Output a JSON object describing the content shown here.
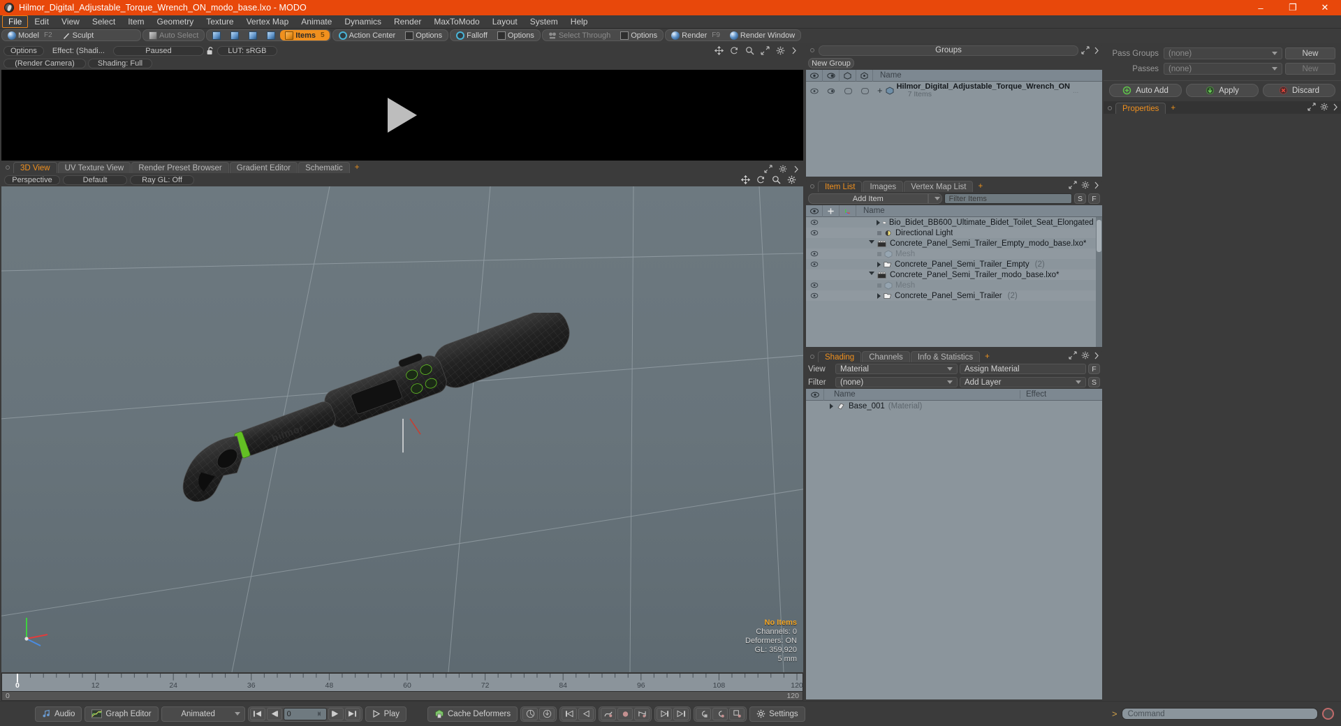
{
  "window": {
    "title": "Hilmor_Digital_Adjustable_Torque_Wrench_ON_modo_base.lxo - MODO",
    "minimize": "–",
    "maximize": "❐",
    "close": "✕"
  },
  "menubar": {
    "items": [
      {
        "label": "File",
        "active": true
      },
      {
        "label": "Edit",
        "active": false
      },
      {
        "label": "View",
        "active": false
      },
      {
        "label": "Select",
        "active": false
      },
      {
        "label": "Item",
        "active": false
      },
      {
        "label": "Geometry",
        "active": false
      },
      {
        "label": "Texture",
        "active": false
      },
      {
        "label": "Vertex Map",
        "active": false
      },
      {
        "label": "Animate",
        "active": false
      },
      {
        "label": "Dynamics",
        "active": false
      },
      {
        "label": "Render",
        "active": false
      },
      {
        "label": "MaxToModo",
        "active": false
      },
      {
        "label": "Layout",
        "active": false
      },
      {
        "label": "System",
        "active": false
      },
      {
        "label": "Help",
        "active": false
      }
    ]
  },
  "modebar": {
    "model": "Model",
    "model_key": "F2",
    "sculpt": "Sculpt",
    "auto_select": "Auto Select",
    "items": "Items",
    "items_key": "5",
    "action_center": "Action Center",
    "options1": "Options",
    "falloff": "Falloff",
    "options2": "Options",
    "select_through": "Select Through",
    "options3": "Options",
    "render": "Render",
    "render_key": "F9",
    "render_window": "Render Window"
  },
  "render_preview": {
    "options": "Options",
    "effect": "Effect: (Shadi...",
    "paused": "Paused",
    "lut": "LUT: sRGB",
    "camera": "(Render Camera)",
    "shading": "Shading: Full",
    "lock_icon": "unlock-icon",
    "play_icon": "play-triangle"
  },
  "viewport": {
    "tabs": [
      {
        "label": "3D View",
        "active": true
      },
      {
        "label": "UV Texture View",
        "active": false
      },
      {
        "label": "Render Preset Browser",
        "active": false
      },
      {
        "label": "Gradient Editor",
        "active": false
      },
      {
        "label": "Schematic",
        "active": false
      }
    ],
    "tab_add": "+",
    "header": {
      "perspective": "Perspective",
      "shading": "Default",
      "raygl": "Ray GL: Off"
    },
    "stats": {
      "selection": "No Items",
      "channels": "Channels: 0",
      "deformers": "Deformers: ON",
      "gl": "GL: 359,920",
      "scale": "5 mm"
    },
    "axis": {
      "x": "X",
      "y": "Y",
      "z": "Z"
    }
  },
  "timeline": {
    "ticks": [
      "0",
      "12",
      "24",
      "36",
      "48",
      "60",
      "72",
      "84",
      "96",
      "108",
      "120"
    ],
    "range_start": "0",
    "range_end": "120",
    "current_frame": 0
  },
  "bottombar": {
    "audio": "Audio",
    "graph_editor": "Graph Editor",
    "mode": "Animated",
    "frame_value": "0",
    "play": "Play",
    "cache_deformers": "Cache Deformers",
    "settings": "Settings",
    "transport": {
      "first": "⏮",
      "prev": "⏴",
      "next": "⏵",
      "last": "⏭"
    }
  },
  "groups_panel": {
    "title": "Groups",
    "new_group": "New Group",
    "columns": [
      "eye-icon",
      "render-icon",
      "shade-icon",
      "lock-icon",
      "Name"
    ],
    "name_column": "Name",
    "rows": [
      {
        "name": "Hilmor_Digital_Adjustable_Torque_Wrench_ON",
        "sub": "7 Items",
        "ellipsis": "..."
      }
    ]
  },
  "item_list_panel": {
    "tabs": [
      {
        "label": "Item List",
        "active": true
      },
      {
        "label": "Images",
        "active": false
      },
      {
        "label": "Vertex Map List",
        "active": false
      }
    ],
    "tab_add": "+",
    "add_item": "Add Item",
    "filter_placeholder": "Filter Items",
    "btn_s": "S",
    "btn_f": "F",
    "name_column": "Name",
    "rows": [
      {
        "name": "Bio_Bidet_BB600_Ultimate_Bidet_Toilet_Seat_Elongated",
        "icon": "folder-icon",
        "indent": 2,
        "arrow": "right",
        "dim": false,
        "trail": "...",
        "eye": true
      },
      {
        "name": "Directional Light",
        "icon": "light-icon",
        "indent": 2,
        "arrow": "none",
        "dim": false,
        "eye": true
      },
      {
        "name": "Concrete_Panel_Semi_Trailer_Empty_modo_base.lxo*",
        "icon": "scene-icon",
        "indent": 1,
        "arrow": "down",
        "dim": false,
        "eye": false
      },
      {
        "name": "Mesh",
        "icon": "mesh-icon",
        "indent": 2,
        "arrow": "none",
        "dim": true,
        "eye": true
      },
      {
        "name": "Concrete_Panel_Semi_Trailer_Empty",
        "icon": "folder-icon",
        "indent": 2,
        "arrow": "right",
        "dim": false,
        "count": "(2)",
        "eye": true
      },
      {
        "name": "Concrete_Panel_Semi_Trailer_modo_base.lxo*",
        "icon": "scene-icon",
        "indent": 1,
        "arrow": "down",
        "dim": false,
        "eye": false
      },
      {
        "name": "Mesh",
        "icon": "mesh-icon",
        "indent": 2,
        "arrow": "none",
        "dim": true,
        "eye": true
      },
      {
        "name": "Concrete_Panel_Semi_Trailer",
        "icon": "folder-icon",
        "indent": 2,
        "arrow": "right",
        "dim": false,
        "count": "(2)",
        "eye": true
      }
    ]
  },
  "shading_panel": {
    "tabs": [
      {
        "label": "Shading",
        "active": true
      },
      {
        "label": "Channels",
        "active": false
      },
      {
        "label": "Info & Statistics",
        "active": false
      }
    ],
    "tab_add": "+",
    "view_label": "View",
    "view_value": "Material",
    "assign_material": "Assign Material",
    "btn_f": "F",
    "filter_label": "Filter",
    "filter_value": "(none)",
    "add_layer": "Add Layer",
    "btn_s": "S",
    "col_name": "Name",
    "col_effect": "Effect",
    "rows": [
      {
        "name": "Base_001",
        "type": "(Material)",
        "effect": ""
      }
    ]
  },
  "passes_panel": {
    "pass_groups_label": "Pass Groups",
    "pass_groups_value": "(none)",
    "pass_groups_new": "New",
    "passes_label": "Passes",
    "passes_value": "(none)",
    "passes_new": "New",
    "auto_add": "Auto Add",
    "apply": "Apply",
    "discard": "Discard"
  },
  "properties_panel": {
    "tabs": [
      {
        "label": "Properties",
        "active": true
      }
    ],
    "tab_add": "+"
  },
  "command_bar": {
    "prompt": ">",
    "placeholder": "Command",
    "record_icon": "record-icon"
  },
  "colors": {
    "accent_orange": "#f0901e",
    "titlebar_red": "#e8480b",
    "panel_bg": "#3b3b3b",
    "list_bg": "#8b959c",
    "viewport_bg": "#6d7980",
    "status_highlight": "#f5a623",
    "model_green": "#5ec014"
  }
}
